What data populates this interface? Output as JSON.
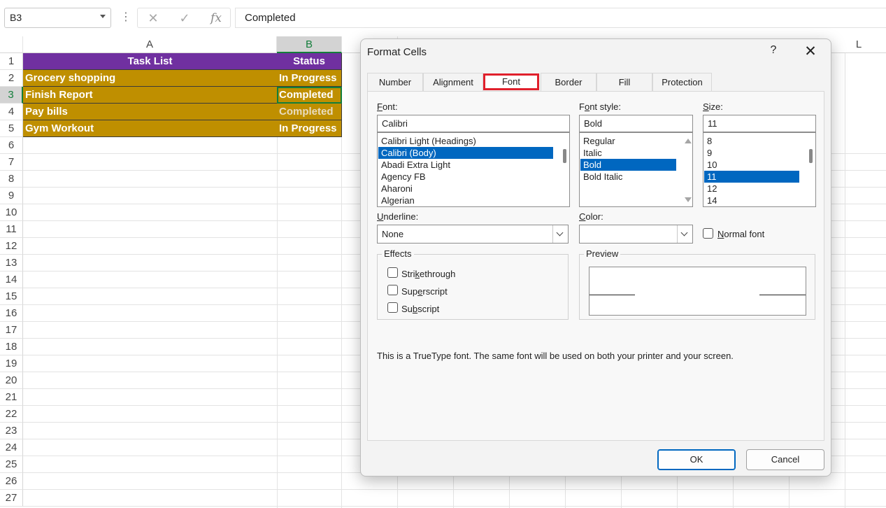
{
  "formula_bar": {
    "name_box": "B3",
    "more_icon": "⋮",
    "cancel_icon": "✕",
    "enter_icon": "✓",
    "fx_label": "fx",
    "content": "Completed"
  },
  "sheet": {
    "columns": [
      "A",
      "B",
      "L"
    ],
    "rows": [
      "1",
      "2",
      "3",
      "4",
      "5",
      "6",
      "7",
      "8",
      "9",
      "10",
      "11",
      "12",
      "13",
      "14",
      "15",
      "16",
      "17",
      "18",
      "19",
      "20",
      "21",
      "22",
      "23",
      "24",
      "25",
      "26",
      "27"
    ],
    "header": {
      "a": "Task List",
      "b": "Status"
    },
    "data": [
      {
        "task": "Grocery shopping",
        "status": "In Progress"
      },
      {
        "task": "Finish Report",
        "status": "Completed"
      },
      {
        "task": "Pay bills",
        "status": "Completed"
      },
      {
        "task": "Gym Workout",
        "status": "In Progress"
      }
    ],
    "colors": {
      "header_fill": "#7030a0",
      "row_fill": "#bf8f00",
      "selection": "#137e3b"
    }
  },
  "dialog": {
    "title": "Format Cells",
    "help": "?",
    "close": "✕",
    "tabs": [
      "Number",
      "Alignment",
      "Font",
      "Border",
      "Fill",
      "Protection"
    ],
    "active_tab": "Font",
    "font": {
      "label_pre": "",
      "label_u": "F",
      "label_post": "ont:",
      "value": "Calibri",
      "options": [
        "Calibri Light (Headings)",
        "Calibri (Body)",
        "Abadi Extra Light",
        "Agency FB",
        "Aharoni",
        "Algerian"
      ],
      "selected": "Calibri (Body)"
    },
    "font_style": {
      "label_pre": "F",
      "label_u": "o",
      "label_post": "nt style:",
      "value": "Bold",
      "options": [
        "Regular",
        "Italic",
        "Bold",
        "Bold Italic"
      ],
      "selected": "Bold"
    },
    "size": {
      "label_pre": "",
      "label_u": "S",
      "label_post": "ize:",
      "value": "11",
      "options": [
        "8",
        "9",
        "10",
        "11",
        "12",
        "14"
      ],
      "selected": "11"
    },
    "underline": {
      "label_pre": "",
      "label_u": "U",
      "label_post": "nderline:",
      "value": "None"
    },
    "color": {
      "label_pre": "",
      "label_u": "C",
      "label_post": "olor:",
      "value": ""
    },
    "normal_font": {
      "label_pre": "",
      "label_u": "N",
      "label_post": "ormal font",
      "checked": false
    },
    "effects": {
      "title": "Effects",
      "strikethrough": {
        "pre": "Stri",
        "u": "k",
        "post": "ethrough",
        "checked": false
      },
      "superscript": {
        "pre": "Sup",
        "u": "e",
        "post": "rscript",
        "checked": false
      },
      "subscript": {
        "pre": "Su",
        "u": "b",
        "post": "script",
        "checked": false
      }
    },
    "preview": {
      "title": "Preview"
    },
    "info": "This is a TrueType font.  The same font will be used on both your printer and your screen.",
    "ok": "OK",
    "cancel": "Cancel",
    "colors": {
      "selection": "#0067c0",
      "tab_highlight": "#e0202c"
    }
  }
}
